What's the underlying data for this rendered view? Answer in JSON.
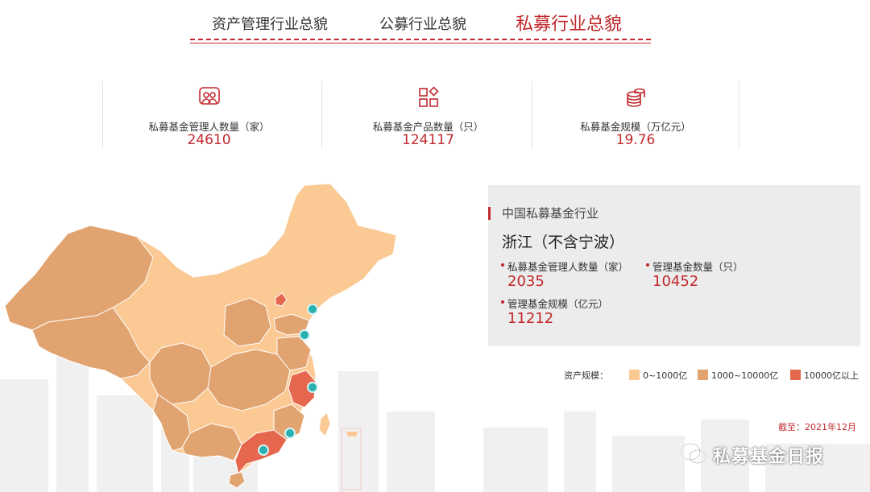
{
  "tabs": [
    {
      "label": "资产管理行业总貌",
      "active": false
    },
    {
      "label": "公募行业总貌",
      "active": false
    },
    {
      "label": "私募行业总貌",
      "active": true
    }
  ],
  "stats": [
    {
      "icon": "people-icon",
      "label": "私募基金管理人数量（家）",
      "value": "24610"
    },
    {
      "icon": "products-grid-icon",
      "label": "私募基金产品数量（只）",
      "value": "124117"
    },
    {
      "icon": "coin-stack-icon",
      "label": "私募基金规模（万亿元）",
      "value": "19.76"
    }
  ],
  "info_panel": {
    "subtitle": "中国私募基金行业",
    "region": "浙江（不含宁波）",
    "metrics": [
      {
        "label": "私募基金管理人数量（家）",
        "value": "2035"
      },
      {
        "label": "管理基金数量（只）",
        "value": "10452"
      },
      {
        "label": "管理基金规模（亿元）",
        "value": "11212"
      }
    ]
  },
  "legend": {
    "title": "资产规模：",
    "items": [
      {
        "label": "0~1000亿",
        "color": "#fbc994"
      },
      {
        "label": "1000~10000亿",
        "color": "#e1a470"
      },
      {
        "label": "10000亿以上",
        "color": "#e5674e"
      }
    ]
  },
  "as_of": "截至：2021年12月",
  "watermark": {
    "icon": "wechat-icon",
    "text": "私募基金日报"
  },
  "colors": {
    "accent": "#c0282d",
    "marker": "#2ab0b0",
    "panel_bg": "#ececec"
  }
}
